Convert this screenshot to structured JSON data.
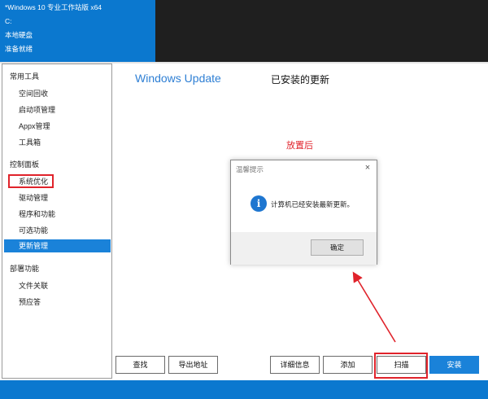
{
  "header": {
    "line1": "*Windows 10 专业工作站版 x64",
    "line2": "C:",
    "line3": "本地硬盘",
    "line4": "准备就绪"
  },
  "sidebar": {
    "groups": [
      {
        "title": "常用工具",
        "items": [
          "空间回收",
          "启动项管理",
          "Appx管理",
          "工具箱"
        ]
      },
      {
        "title": "控制面板",
        "items": [
          "系统优化",
          "驱动管理",
          "程序和功能",
          "可选功能",
          "更新管理"
        ]
      },
      {
        "title": "部署功能",
        "items": [
          "文件关联",
          "预应答"
        ]
      }
    ],
    "active_item": "更新管理"
  },
  "main": {
    "title": "Windows Update",
    "subtitle": "已安装的更新"
  },
  "annotation": {
    "caption": "放置后"
  },
  "dialog": {
    "title": "温馨提示",
    "close_glyph": "×",
    "message": "计算机已经安装最新更新。",
    "ok_label": "确定",
    "icon_glyph": "i"
  },
  "buttons": {
    "find": "查找",
    "export": "导出地址",
    "details": "详细信息",
    "add": "添加",
    "scan": "扫描",
    "install": "安装"
  },
  "colors": {
    "accent": "#0b78cf",
    "highlight": "#1a82d9",
    "annotation_red": "#e0232b"
  }
}
